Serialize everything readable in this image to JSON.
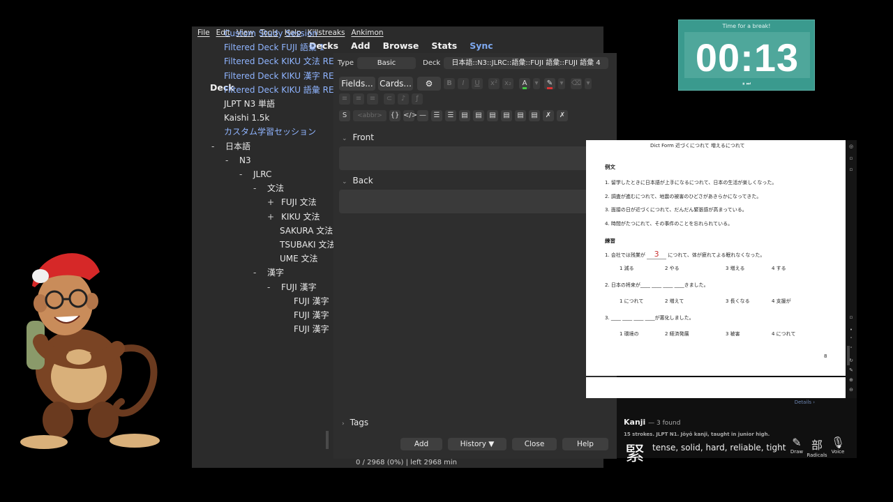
{
  "menu": [
    "File",
    "Edit",
    "View",
    "Tools",
    "Help",
    "Killstreaks",
    "Ankimon"
  ],
  "toolbar": {
    "decks": "Decks",
    "add": "Add",
    "browse": "Browse",
    "stats": "Stats",
    "sync": "Sync"
  },
  "deck_header": "Deck",
  "decks": [
    {
      "label": "Custom Study Session",
      "filtered": true,
      "exp": ""
    },
    {
      "label": "Filtered Deck FUJI 語彙 1",
      "filtered": true,
      "exp": ""
    },
    {
      "label": "Filtered Deck KIKU 文法 RED",
      "filtered": true,
      "exp": ""
    },
    {
      "label": "Filtered Deck KIKU 漢字 RED",
      "filtered": true,
      "exp": ""
    },
    {
      "label": "Filtered Deck KIKU 語彙 RED",
      "filtered": true,
      "exp": ""
    },
    {
      "label": "JLPT N3 単語",
      "filtered": false,
      "exp": ""
    },
    {
      "label": "Kaishi 1.5k",
      "filtered": false,
      "exp": ""
    },
    {
      "label": "カスタム学習セッション",
      "filtered": true,
      "exp": ""
    },
    {
      "label": "日本語",
      "filtered": false,
      "exp": "-"
    },
    {
      "label": "N3",
      "filtered": false,
      "exp": "-"
    },
    {
      "label": "JLRC",
      "filtered": false,
      "exp": "-"
    },
    {
      "label": "文法",
      "filtered": false,
      "exp": "-"
    },
    {
      "label": "FUJI 文法",
      "filtered": false,
      "exp": "+"
    },
    {
      "label": "KIKU 文法",
      "filtered": false,
      "exp": "+"
    },
    {
      "label": "SAKURA 文法",
      "filtered": false,
      "exp": ""
    },
    {
      "label": "TSUBAKI 文法",
      "filtered": false,
      "exp": ""
    },
    {
      "label": "UME 文法",
      "filtered": false,
      "exp": ""
    },
    {
      "label": "漢字",
      "filtered": false,
      "exp": "-"
    },
    {
      "label": "FUJI 漢字",
      "filtered": false,
      "exp": "-"
    },
    {
      "label": "FUJI 漢字",
      "filtered": false,
      "exp": ""
    },
    {
      "label": "FUJI 漢字",
      "filtered": false,
      "exp": ""
    },
    {
      "label": "FUJI 漢字",
      "filtered": false,
      "exp": ""
    }
  ],
  "status_text": "0 / 2968 (0%) | left 2968 min",
  "add": {
    "type_label": "Type",
    "type_value": "Basic",
    "deck_label": "Deck",
    "deck_value": "日本語::N3::JLRC::語彙::FUJI 語彙::FUJI 語彙 4",
    "fields_btn": "Fields...",
    "cards_btn": "Cards...",
    "abbr": "<abbr>",
    "front": "Front",
    "back": "Back",
    "tags": "Tags",
    "btn_add": "Add",
    "btn_history": "History ▼",
    "btn_close": "Close",
    "btn_help": "Help"
  },
  "timer": {
    "title": "Time for a break!",
    "time": "00:13",
    "controls": "⏸ ⏭"
  },
  "doc": {
    "top": "Dict Form   近づくにつれて          増えるにつれて",
    "reibun": "例文",
    "ex1": "1. 留学したときに日本語が上手になるにつれて、日本の生活が楽しくなった。",
    "ex2": "2. 調査が進むにつれて、地震の被害のひどさがあきらかになってきた。",
    "ex3": "3. 面接の日が近づくにつれて、だんだん緊張感が高まっている。",
    "ex4": "4. 時間がたつにれて、その事件のことを忘れられている。",
    "renshu": "練習",
    "q1": "1. 会社では残業が",
    "q1ans": "3",
    "q1rest": "につれて、体が疲れてよる眠れなくなった。",
    "q1opts": [
      "1 減る",
      "2 やる",
      "3 増える",
      "4 する"
    ],
    "q2": "2. 日本の将来が____ ____ ____ ____きました。",
    "q2opts": [
      "1 につれて",
      "2 増えて",
      "3 長くなる",
      "4 支援が"
    ],
    "q3": "3. ____ ____ ____ ____が悪化しました。",
    "q3opts": [
      "1 環境の",
      "2 経済発展",
      "3 被害",
      "4 につれて"
    ],
    "page": "8"
  },
  "kanji": {
    "details": "Details ›",
    "title": "Kanji",
    "found": "— 3 found",
    "info": "15 strokes. JLPT N1. Jōyō kanji, taught in junior high.",
    "glyph": "緊",
    "meaning": "tense, solid, hard, reliable, tight",
    "tools": [
      {
        "glyph": "✎",
        "label": "Draw"
      },
      {
        "glyph": "部",
        "label": "Radicals"
      },
      {
        "glyph": "🎙",
        "label": "Voice"
      }
    ]
  }
}
